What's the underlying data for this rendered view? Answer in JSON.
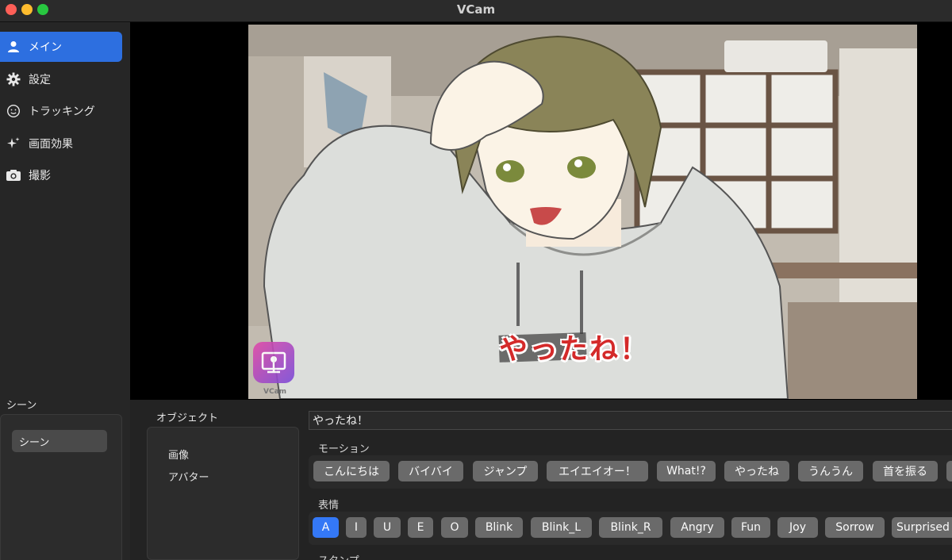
{
  "window": {
    "title": "VCam"
  },
  "sidebar": {
    "items": [
      {
        "label": "メイン",
        "icon": "person-icon",
        "active": true
      },
      {
        "label": "設定",
        "icon": "gear-icon",
        "active": false
      },
      {
        "label": "トラッキング",
        "icon": "face-icon",
        "active": false
      },
      {
        "label": "画面効果",
        "icon": "sparkles-icon",
        "active": false
      },
      {
        "label": "撮影",
        "icon": "camera-icon",
        "active": false
      }
    ]
  },
  "scene": {
    "heading": "シーン",
    "items": [
      "シーン"
    ]
  },
  "preview": {
    "caption": "やったね！",
    "watermark_label": "VCam"
  },
  "objects": {
    "heading": "オブジェクト",
    "items": [
      "画像",
      "アバター"
    ]
  },
  "message": {
    "value": "やったね！"
  },
  "motion": {
    "label": "モーション",
    "buttons": [
      "こんにちは",
      "バイバイ",
      "ジャンプ",
      "エイエイオー！",
      "What!?",
      "やったね",
      "うんうん",
      "首を振る"
    ]
  },
  "expression": {
    "label": "表情",
    "selected": "A",
    "buttons": [
      "A",
      "I",
      "U",
      "E",
      "O",
      "Blink",
      "Blink_L",
      "Blink_R",
      "Angry",
      "Fun",
      "Joy",
      "Sorrow",
      "Surprised"
    ]
  },
  "stamp": {
    "label": "スタンプ"
  },
  "colors": {
    "accent": "#2d6fe0",
    "selected_button": "#3478f6",
    "caption_red": "#d42a2a"
  }
}
